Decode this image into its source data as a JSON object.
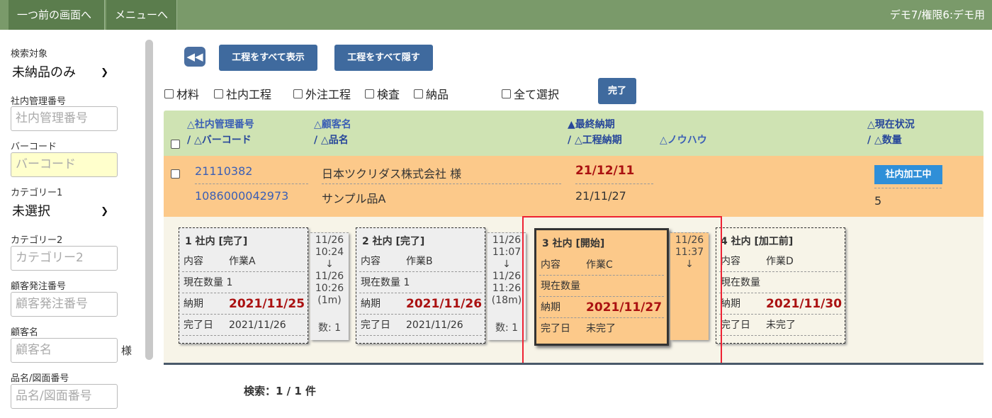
{
  "topbar": {
    "back_label": "一つ前の画面へ",
    "menu_label": "メニューへ",
    "user_label": "デモ7/権限6:デモ用"
  },
  "sidebar": {
    "search_target_label": "検索対象",
    "search_target_value": "未納品のみ",
    "mgmt_no_label": "社内管理番号",
    "mgmt_no_placeholder": "社内管理番号",
    "barcode_label": "バーコード",
    "barcode_placeholder": "バーコード",
    "category1_label": "カテゴリー1",
    "category1_value": "未選択",
    "category2_label": "カテゴリー2",
    "category2_placeholder": "カテゴリー2",
    "customer_order_label": "顧客発注番号",
    "customer_order_placeholder": "顧客発注番号",
    "customer_name_label": "顧客名",
    "customer_name_placeholder": "顧客名",
    "customer_suffix": "様",
    "product_label": "品名/図面番号",
    "product_placeholder": "品名/図面番号"
  },
  "toolbar": {
    "show_all_label": "工程をすべて表示",
    "hide_all_label": "工程をすべて隠す",
    "complete_label": "完了"
  },
  "filters": {
    "material": "材料",
    "internal": "社内工程",
    "external": "外注工程",
    "inspection": "検査",
    "delivery": "納品",
    "select_all": "全て選択"
  },
  "table": {
    "headers": {
      "mgmt_no": "△社内管理番号",
      "barcode": "/ △バーコード",
      "customer": "△顧客名",
      "product": "/ △品名",
      "final_due": "▲最終納期",
      "process_due": "/ △工程納期",
      "knowhow": "△ノウハウ",
      "status": "△現在状況",
      "quantity": "/ △数量"
    },
    "row": {
      "mgmt_no": "21110382",
      "barcode": "1086000042973",
      "customer": "日本ツクリダス株式会社 様",
      "product": "サンプル品A",
      "final_due": "21/12/11",
      "process_due": "21/11/27",
      "status": "社内加工中",
      "quantity": "5"
    }
  },
  "process_labels": {
    "content": "内容",
    "current_qty": "現在数量",
    "due": "納期",
    "completed": "完了日"
  },
  "processes": [
    {
      "title": "1 社内 [完了]",
      "content": "作業A",
      "qty": "1",
      "due": "2021/11/25",
      "completed": "2021/11/26"
    },
    {
      "title": "2 社内 [完了]",
      "content": "作業B",
      "qty": "1",
      "due": "2021/11/26",
      "completed": "2021/11/26"
    },
    {
      "title": "3 社内 [開始]",
      "content": "作業C",
      "qty": "",
      "due": "2021/11/27",
      "completed": "未完了"
    },
    {
      "title": "4 社内 [加工前]",
      "content": "作業D",
      "qty": "",
      "due": "2021/11/30",
      "completed": "未完了"
    }
  ],
  "connectors": [
    {
      "l1": "11/26",
      "l2": "10:24",
      "l3": "↓",
      "l4": "11/26",
      "l5": "10:26",
      "l6": "(1m)",
      "count": "数: 1"
    },
    {
      "l1": "11/26",
      "l2": "11:07",
      "l3": "↓",
      "l4": "11/26",
      "l5": "11:26",
      "l6": "(18m)",
      "count": "数: 1"
    },
    {
      "l1": "11/26",
      "l2": "11:37",
      "l3": "↓",
      "l4": "",
      "l5": "",
      "l6": "",
      "count": ""
    }
  ],
  "footer": {
    "count_text": "検索：1 / 1 件"
  }
}
